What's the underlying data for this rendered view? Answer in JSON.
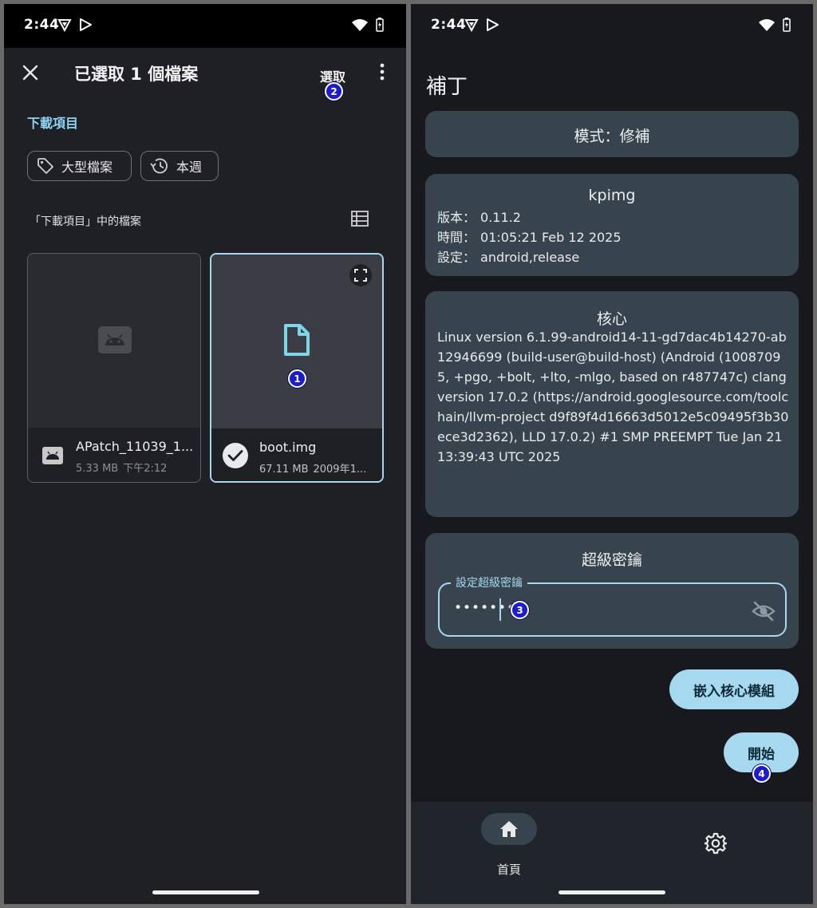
{
  "left": {
    "status": {
      "time": "2:44"
    },
    "header": {
      "title": "已選取 1 個檔案",
      "select_label": "選取"
    },
    "section_label": "下載項目",
    "chips": [
      {
        "label": "大型檔案"
      },
      {
        "label": "本週"
      }
    ],
    "files_heading": "「下載項目」中的檔案",
    "files": [
      {
        "name": "APatch_11039_1...",
        "size": "5.33 MB",
        "date": "下午2:12",
        "selected": false
      },
      {
        "name": "boot.img",
        "size": "67.11 MB",
        "date": "2009年1...",
        "selected": true
      }
    ],
    "badges": {
      "file": "1",
      "select": "2"
    }
  },
  "right": {
    "status": {
      "time": "2:44"
    },
    "title": "補丁",
    "mode": {
      "text": "模式：修補"
    },
    "kpimg": {
      "title": "kpimg",
      "rows": [
        {
          "label": "版本：",
          "value": "0.11.2"
        },
        {
          "label": "時間：",
          "value": "01:05:21 Feb 12 2025"
        },
        {
          "label": "設定：",
          "value": "android,release"
        }
      ]
    },
    "kernel": {
      "title": "核心",
      "text": "Linux version 6.1.99-android14-11-gd7dac4b14270-ab12946699 (build-user@build-host) (Android (10087095, +pgo, +bolt, +lto, -mlgo, based on r487747c) clang version 17.0.2 (https://android.googlesource.com/toolchain/llvm-project d9f89f4d16663d5012e5c09495f3b30ece3d2362), LLD 17.0.2) #1 SMP PREEMPT Tue Jan 21 13:39:43 UTC 2025"
    },
    "superkey": {
      "title": "超級密鑰",
      "field_label": "設定超級密鑰",
      "value": "••••••••"
    },
    "buttons": {
      "embed": "嵌入核心模組",
      "start": "開始"
    },
    "nav": {
      "home": "首頁"
    },
    "badges": {
      "password": "3",
      "start": "4"
    }
  },
  "colors": {
    "accent": "#a6d8f0",
    "panel": "#37444e",
    "badge": "#1c1cc8"
  }
}
